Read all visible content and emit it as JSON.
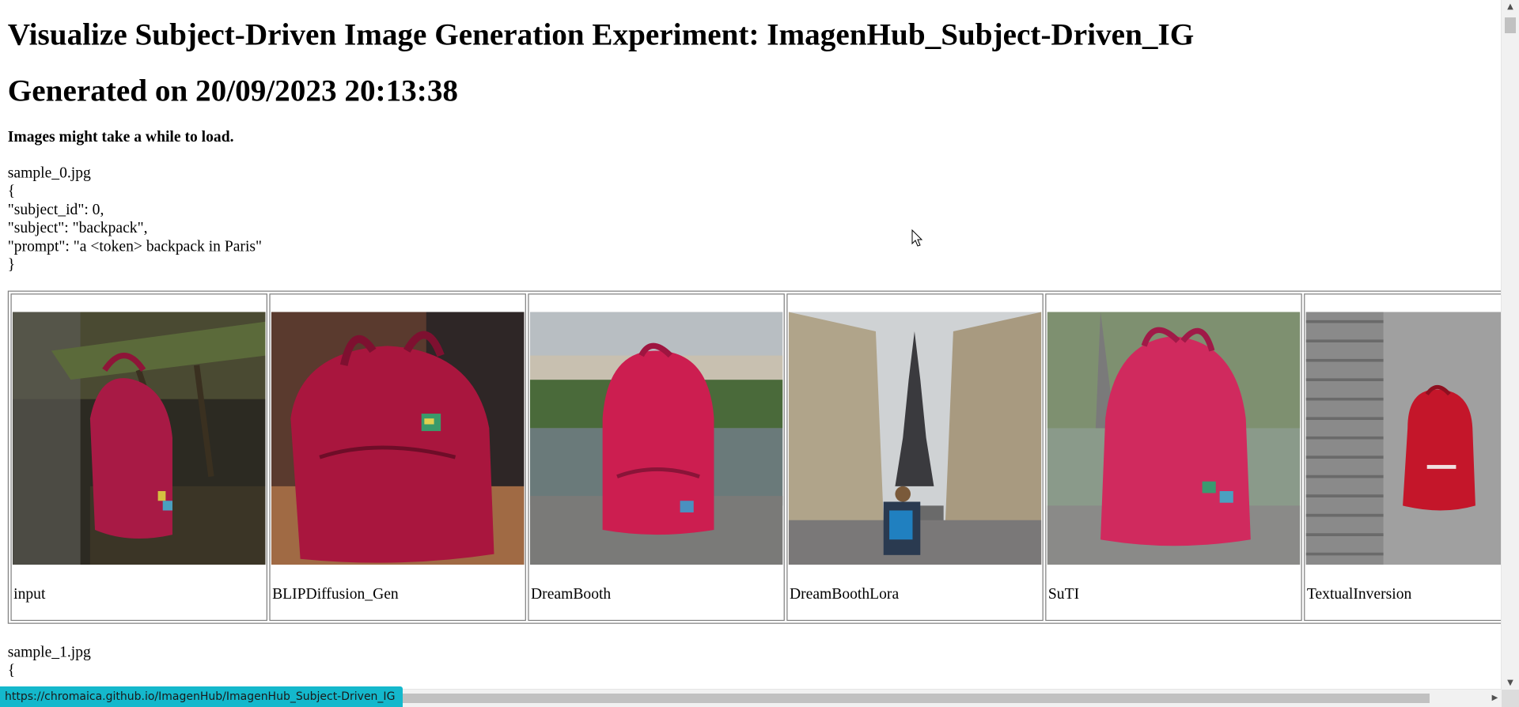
{
  "page": {
    "title": "Visualize Subject-Driven Image Generation Experiment: ImagenHub_Subject-Driven_IG",
    "generated": "Generated on 20/09/2023 20:13:38",
    "note": "Images might take a while to load."
  },
  "samples": [
    {
      "name": "sample_0.jpg",
      "meta_lines": [
        "{",
        "\"subject_id\": 0,",
        "\"subject\": \"backpack\",",
        "\"prompt\": \"a <token> backpack in Paris\"",
        "}"
      ],
      "results": [
        {
          "label": "input"
        },
        {
          "label": "BLIPDiffusion_Gen"
        },
        {
          "label": "DreamBooth"
        },
        {
          "label": "DreamBoothLora"
        },
        {
          "label": "SuTI"
        },
        {
          "label": "TextualInversion"
        }
      ]
    },
    {
      "name": "sample_1.jpg",
      "meta_first": "{"
    }
  ],
  "status_bar": {
    "url": "https://chromaica.github.io/ImagenHub/ImagenHub_Subject-Driven_IG"
  },
  "colors": {
    "backpack": "#b0173f",
    "status_bg": "#14b8cc"
  }
}
